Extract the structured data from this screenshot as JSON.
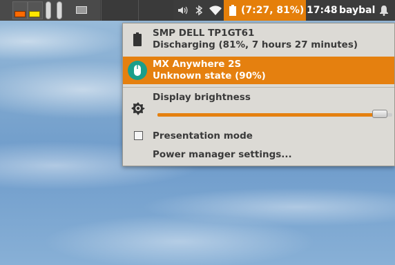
{
  "panel": {
    "battery_status": "(7:27, 81%)",
    "clock": "17:48",
    "username": "baybal"
  },
  "menu": {
    "devices": [
      {
        "name": "SMP DELL TP1GT61",
        "status": "Discharging (81%, 7 hours 27 minutes)",
        "icon": "battery-icon"
      },
      {
        "name": "MX Anywhere 2S",
        "status": "Unknown state (90%)",
        "icon": "mouse-icon"
      }
    ],
    "brightness": {
      "label": "Display brightness",
      "level": 0.98
    },
    "presentation_mode": {
      "label": "Presentation mode",
      "checked": false
    },
    "power_manager_settings": {
      "label": "Power manager settings..."
    }
  },
  "colors": {
    "accent": "#e5800f",
    "panel": "#3c3c3c",
    "menu_bg": "#dcdad5"
  }
}
